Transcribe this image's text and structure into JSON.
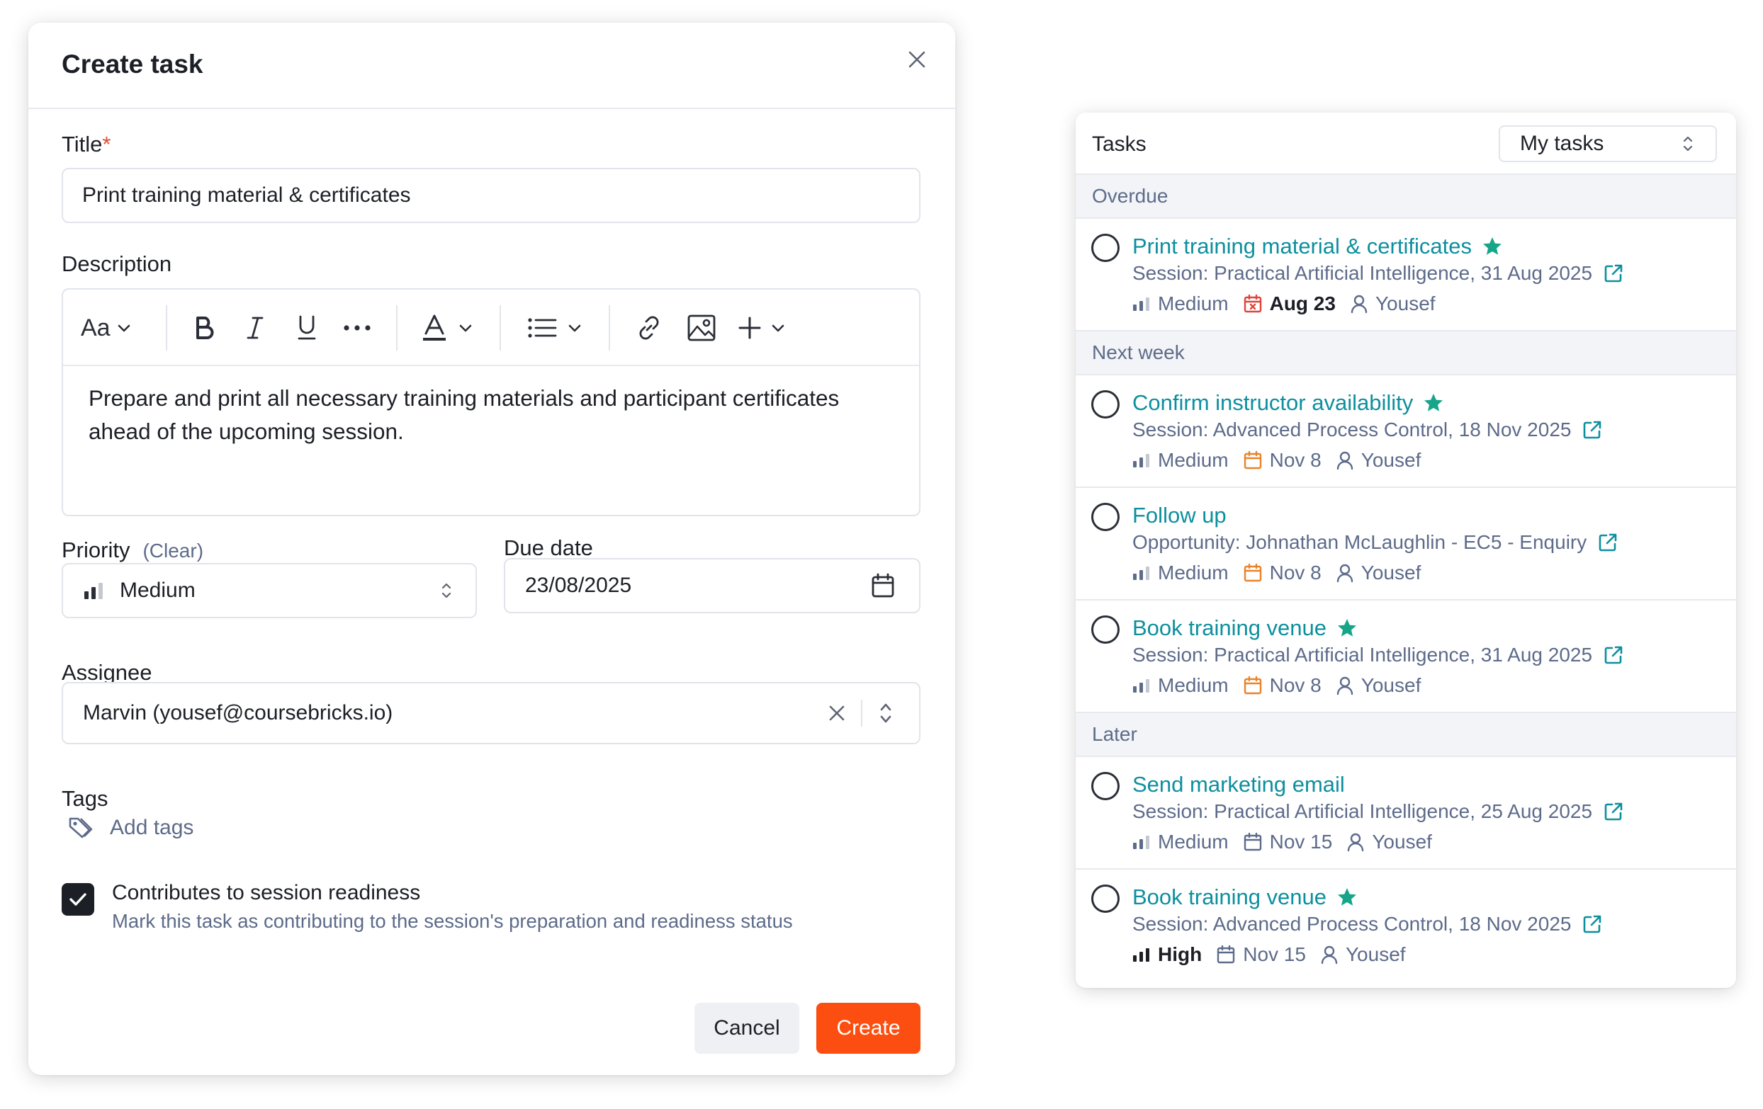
{
  "modal": {
    "title": "Create task",
    "title_label": "Title",
    "required_mark": "*",
    "title_value": "Print training material & certificates",
    "description_label": "Description",
    "toolbar": {
      "font_size_label": "Aa"
    },
    "description_text": "Prepare and print all necessary training materials and participant certificates ahead of the upcoming session.",
    "priority_label": "Priority",
    "priority_clear": "(Clear)",
    "priority_value": "Medium",
    "due_date_label": "Due date",
    "due_date_value": "23/08/2025",
    "assignee_label": "Assignee",
    "assignee_value": "Marvin (yousef@coursebricks.io)",
    "tags_label": "Tags",
    "add_tags": "Add tags",
    "readiness_checked": true,
    "readiness_title": "Contributes to session readiness",
    "readiness_desc": "Mark this task as contributing to the session's preparation and readiness status",
    "cancel_label": "Cancel",
    "create_label": "Create"
  },
  "colors": {
    "accent": "#fc4e10",
    "link": "#0d8f9e",
    "star": "#17a589",
    "overdue": "#e0433a",
    "date": "#e8832a",
    "muted": "#5d6b8a"
  },
  "panel": {
    "title": "Tasks",
    "filter": "My tasks",
    "groups": [
      {
        "label": "Overdue",
        "tasks": [
          {
            "title": "Print training material & certificates",
            "starred": true,
            "sub": "Session: Practical Artificial Intelligence, 31 Aug 2025",
            "priority": "Medium",
            "date": "Aug 23",
            "assignee": "Yousef"
          }
        ]
      },
      {
        "label": "Next week",
        "tasks": [
          {
            "title": "Confirm instructor availability",
            "starred": true,
            "sub": "Session: Advanced Process Control, 18 Nov 2025",
            "priority": "Medium",
            "date": "Nov 8",
            "assignee": "Yousef"
          },
          {
            "title": "Follow up",
            "starred": false,
            "sub": "Opportunity: Johnathan McLaughlin - EC5 - Enquiry",
            "priority": "Medium",
            "date": "Nov 8",
            "assignee": "Yousef"
          },
          {
            "title": "Book training venue",
            "starred": true,
            "sub": "Session: Practical Artificial Intelligence, 31 Aug 2025",
            "priority": "Medium",
            "date": "Nov 8",
            "assignee": "Yousef"
          }
        ]
      },
      {
        "label": "Later",
        "tasks": [
          {
            "title": "Send marketing email",
            "starred": false,
            "sub": "Session: Practical Artificial Intelligence, 25 Aug 2025",
            "priority": "Medium",
            "date": "Nov 15",
            "assignee": "Yousef"
          },
          {
            "title": "Book training venue",
            "starred": true,
            "sub": "Session: Advanced Process Control, 18 Nov 2025",
            "priority": "High",
            "date": "Nov 15",
            "assignee": "Yousef"
          }
        ]
      }
    ]
  }
}
